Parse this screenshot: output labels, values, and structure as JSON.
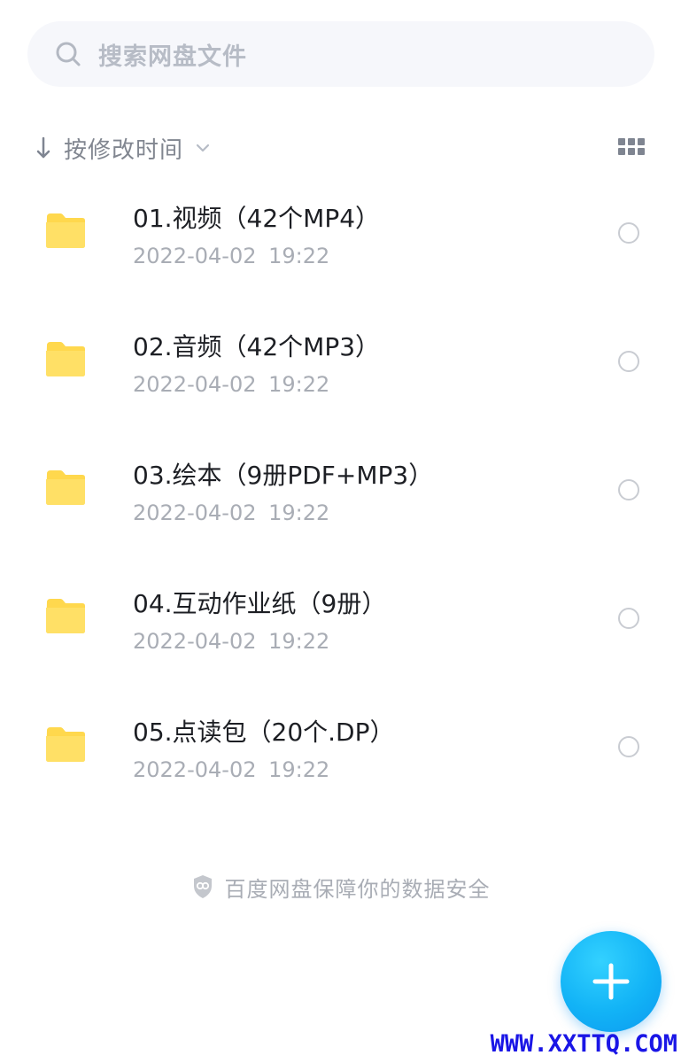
{
  "search": {
    "placeholder": "搜索网盘文件"
  },
  "sort": {
    "label": "按修改时间"
  },
  "files": [
    {
      "name": "01.视频（42个MP4）",
      "date": "2022-04-02 19:22"
    },
    {
      "name": "02.音频（42个MP3）",
      "date": "2022-04-02 19:22"
    },
    {
      "name": "03.绘本（9册PDF+MP3）",
      "date": "2022-04-02 19:22"
    },
    {
      "name": "04.互动作业纸（9册）",
      "date": "2022-04-02 19:22"
    },
    {
      "name": "05.点读包（20个.DP）",
      "date": "2022-04-02 19:22"
    }
  ],
  "footer": {
    "security_note": "百度网盘保障你的数据安全"
  },
  "fab": {
    "icon": "plus-icon"
  },
  "watermark": "WWW.XXTTQ.COM",
  "colors": {
    "accent": "#12b3f6",
    "folder": "#ffd84d",
    "muted": "#a9adb5"
  }
}
